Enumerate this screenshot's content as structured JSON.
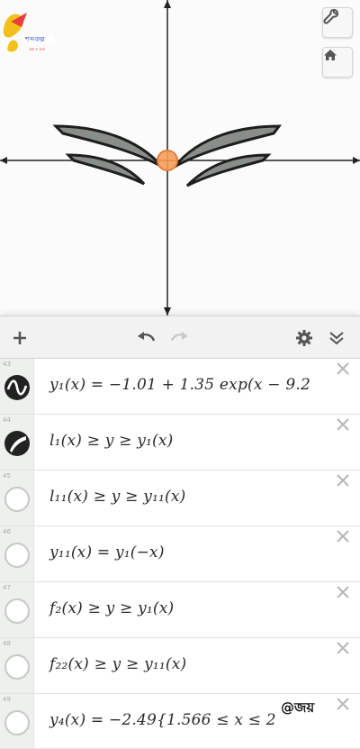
{
  "graph": {
    "settings_icon": "wrench-icon",
    "home_icon": "home-icon",
    "logo_icon": "colorful-logo-icon"
  },
  "toolbar": {
    "add_icon": "plus-icon",
    "undo_icon": "undo-icon",
    "redo_icon": "redo-icon",
    "gear_icon": "gear-icon",
    "collapse_icon": "double-chevron-down-icon"
  },
  "expressions": [
    {
      "num": "43",
      "state": "wave",
      "text": "y₁(x) = −1.01 + 1.35 exp(x − 9.2"
    },
    {
      "num": "44",
      "state": "filled",
      "text": "l₁(x) ≥ y ≥ y₁(x)"
    },
    {
      "num": "45",
      "state": "empty",
      "text": "l₁₁(x) ≥ y ≥ y₁₁(x)"
    },
    {
      "num": "46",
      "state": "empty",
      "text": "y₁₁(x) = y₁(−x)"
    },
    {
      "num": "47",
      "state": "empty",
      "text": "f₂(x) ≥ y ≥ y₁(x)"
    },
    {
      "num": "48",
      "state": "empty",
      "text": "f₂₂(x) ≥ y ≥ y₁₁(x)"
    },
    {
      "num": "49",
      "state": "empty",
      "text": "y₄(x) = −2.49{1.566 ≤ x ≤ 2"
    }
  ],
  "watermark": "@জয়",
  "colors": {
    "wing_fill": "#8a8e8a",
    "center_dot": "#f6a86a",
    "axis": "#222222"
  }
}
